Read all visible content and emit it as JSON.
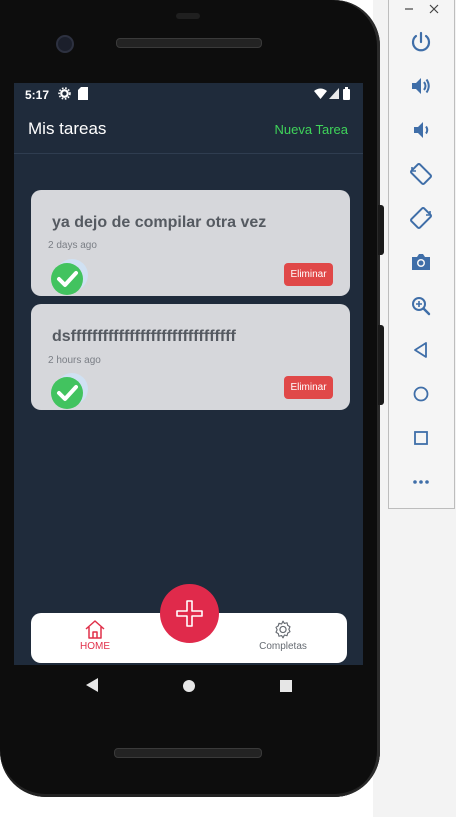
{
  "status_bar": {
    "time": "5:17"
  },
  "app_bar": {
    "title": "Mis tareas",
    "new_task": "Nueva Tarea"
  },
  "tasks": [
    {
      "title": "ya dejo de compilar otra vez",
      "time_ago": "2 days ago",
      "delete_label": "Eliminar"
    },
    {
      "title": "dsfffffffffffffffffffffffffffffff",
      "time_ago": "2 hours ago",
      "delete_label": "Eliminar"
    }
  ],
  "bottom_nav": {
    "home_label": "HOME",
    "completed_label": "Completas"
  },
  "emulator_panel": {
    "window_controls": [
      "minimize-icon",
      "close-icon"
    ],
    "tools": [
      "power-icon",
      "volume-up-icon",
      "volume-down-icon",
      "rotate-left-icon",
      "rotate-right-icon",
      "camera-icon",
      "zoom-icon",
      "back-icon",
      "home-icon",
      "overview-icon",
      "more-icon"
    ]
  },
  "colors": {
    "screen_bg": "#1f2b3b",
    "accent_green": "#3fd45a",
    "card_bg": "#d6d7db",
    "delete_red": "#e04848",
    "fab_red": "#e02a4b",
    "nav_active": "#e0304a"
  }
}
